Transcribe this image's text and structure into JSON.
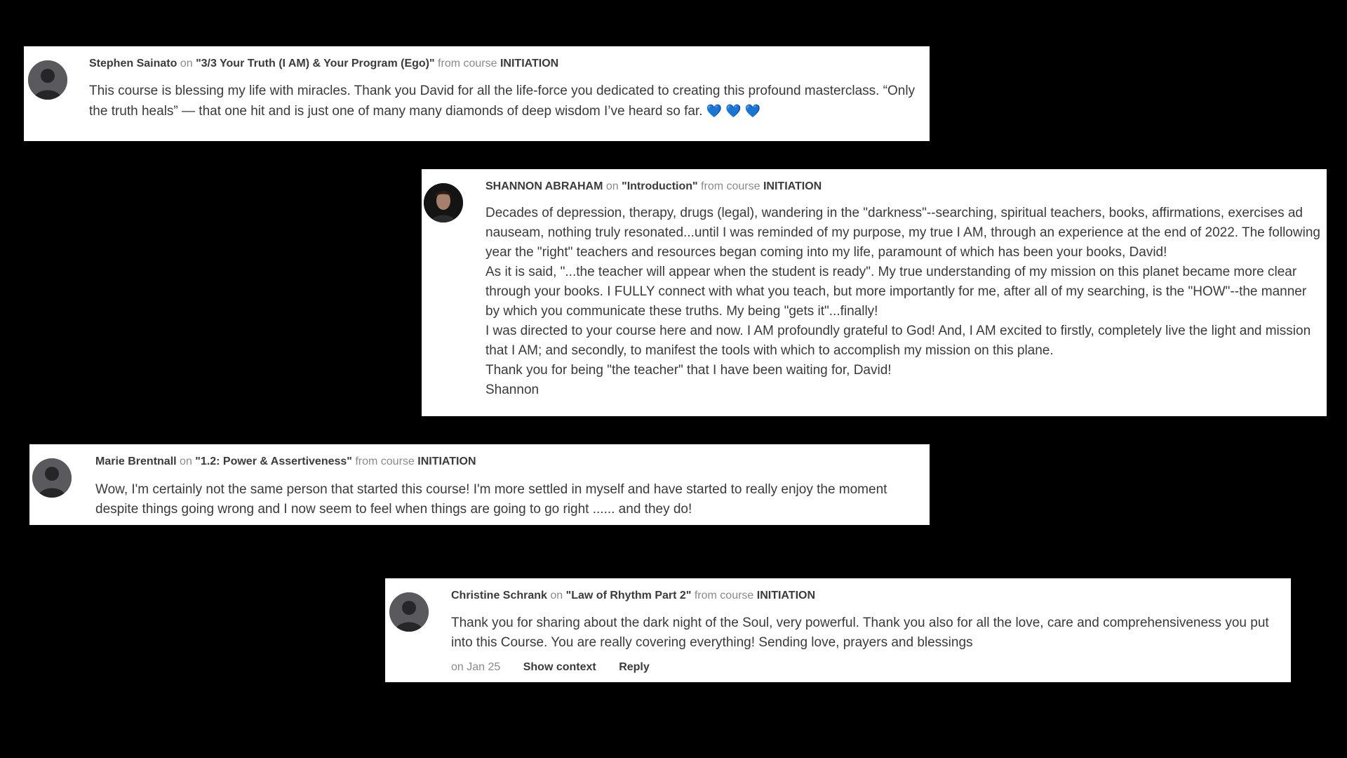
{
  "comments": [
    {
      "author": "Stephen Sainato",
      "on": "on",
      "lesson": "\"3/3 Your Truth (I AM) & Your Program (Ego)\"",
      "from": "from course",
      "course": "INITIATION",
      "body": "This course is blessing my life with miracles. Thank you David for all the life-force you dedicated to creating this profound masterclass. “Only the truth heals” — that one hit and is just one of many many diamonds of deep wisdom I’ve heard so far.",
      "hearts": "💙 💙 💙",
      "avatar_icon": "default-avatar-icon"
    },
    {
      "author": "SHANNON ABRAHAM",
      "on": "on",
      "lesson": "\"Introduction\"",
      "from": "from course",
      "course": "INITIATION",
      "paragraphs": [
        "Decades of depression, therapy, drugs (legal), wandering in the \"darkness\"--searching, spiritual teachers, books, affirmations, exercises ad nauseam, nothing truly resonated...until I was reminded of my purpose, my true I AM, through an experience at the end of 2022. The following year the \"right\" teachers and resources began coming into my life, paramount of which has been your books, David!",
        "As it is said, \"...the teacher will appear when the student is ready\". My true understanding of my mission on this planet became more clear through your books. I FULLY connect with what you teach, but more importantly for me, after all of my searching, is the \"HOW\"--the manner by which you communicate these truths. My being \"gets it\"...finally!",
        "I was directed to your course here and now. I AM profoundly grateful to God! And, I AM excited to firstly, completely live the light and mission that I AM; and secondly, to manifest the tools with which to accomplish my mission on this plane.",
        "Thank you for being \"the teacher\" that I have been waiting for, David!",
        "Shannon"
      ],
      "avatar_icon": "profile-photo-icon"
    },
    {
      "author": "Marie Brentnall",
      "on": "on",
      "lesson": "\"1.2: Power & Assertiveness\"",
      "from": "from course",
      "course": "INITIATION",
      "body": "Wow, I'm certainly not the same person that started this course! I'm more settled in myself and have started to really enjoy the moment despite things going wrong and I now seem to feel when things are going to go right ...... and they do!",
      "avatar_icon": "default-avatar-icon"
    },
    {
      "author": "Christine Schrank",
      "on": "on",
      "lesson": "\"Law of Rhythm Part 2\"",
      "from": "from course",
      "course": "INITIATION",
      "body": "Thank you for sharing about the dark night of the Soul, very powerful. Thank you also for all the love, care and comprehensiveness you put into this Course. You are really covering everything! Sending love, prayers and blessings",
      "date": "on Jan 25",
      "show_context": "Show context",
      "reply": "Reply",
      "avatar_icon": "default-avatar-icon"
    }
  ]
}
